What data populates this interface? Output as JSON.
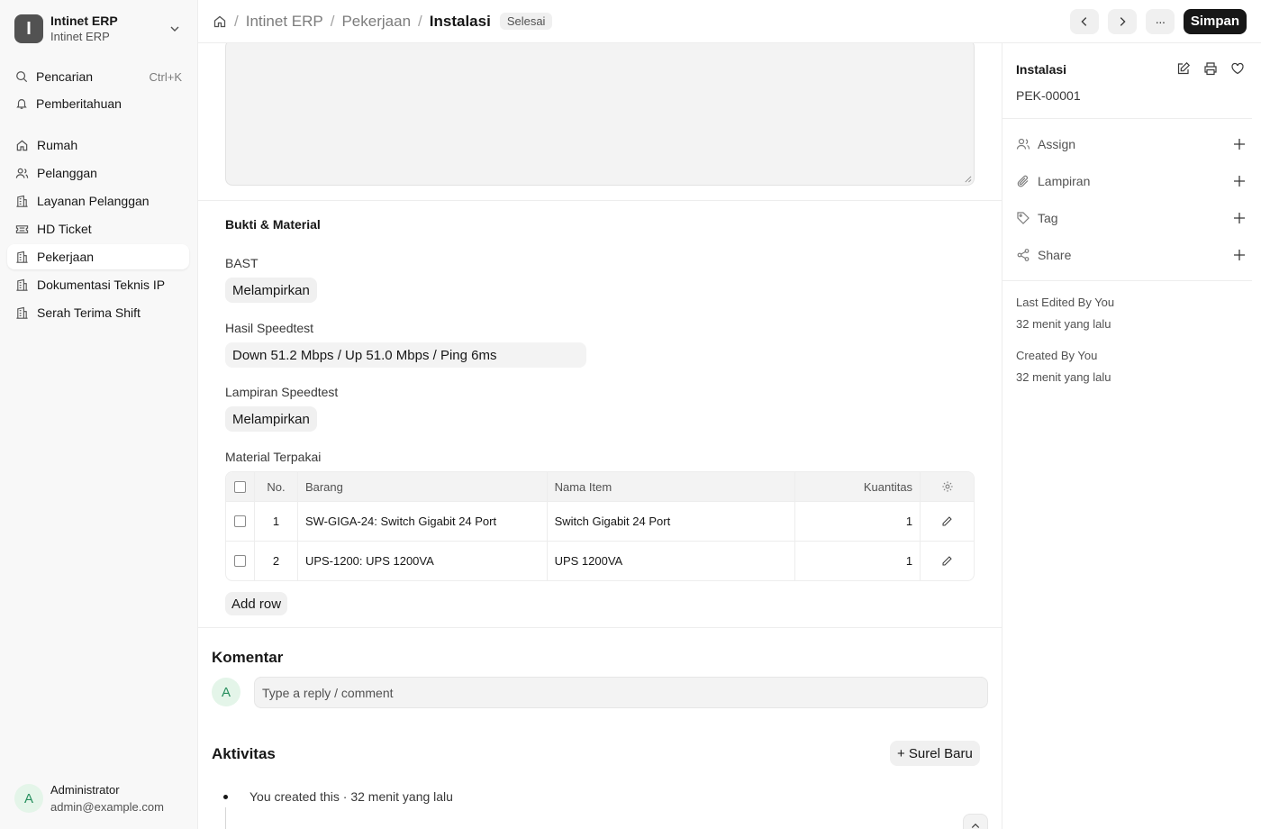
{
  "sidebar": {
    "workspace_title": "Intinet ERP",
    "workspace_sub": "Intinet ERP",
    "workspace_logo": "I",
    "search_label": "Pencarian",
    "search_shortcut": "Ctrl+K",
    "notifications_label": "Pemberitahuan",
    "items": [
      {
        "label": "Rumah",
        "icon": "home-icon"
      },
      {
        "label": "Pelanggan",
        "icon": "users-icon"
      },
      {
        "label": "Layanan Pelanggan",
        "icon": "building-icon"
      },
      {
        "label": "HD Ticket",
        "icon": "ticket-icon"
      },
      {
        "label": "Pekerjaan",
        "icon": "building-icon",
        "active": true
      },
      {
        "label": "Dokumentasi Teknis IP",
        "icon": "building-icon"
      },
      {
        "label": "Serah Terima Shift",
        "icon": "building-icon"
      }
    ],
    "user": {
      "initial": "A",
      "name": "Administrator",
      "email": "admin@example.com"
    }
  },
  "header": {
    "breadcrumbs": [
      "Intinet ERP",
      "Pekerjaan",
      "Instalasi"
    ],
    "status_badge": "Selesai",
    "more_label": "···",
    "save_label": "Simpan"
  },
  "form": {
    "section_title": "Bukti & Material",
    "bast_label": "BAST",
    "bast_button": "Melampirkan",
    "speedtest_label": "Hasil Speedtest",
    "speedtest_value": "Down 51.2 Mbps / Up 51.0 Mbps / Ping 6ms",
    "speedtest_attach_label": "Lampiran Speedtest",
    "speedtest_attach_button": "Melampirkan",
    "material_label": "Material Terpakai",
    "table": {
      "headers": [
        "No.",
        "Barang",
        "Nama Item",
        "Kuantitas"
      ],
      "rows": [
        {
          "no": "1",
          "barang": "SW-GIGA-24: Switch Gigabit 24 Port",
          "nama": "Switch Gigabit 24 Port",
          "qty": "1"
        },
        {
          "no": "2",
          "barang": "UPS-1200: UPS 1200VA",
          "nama": "UPS 1200VA",
          "qty": "1"
        }
      ]
    },
    "add_row_label": "Add row"
  },
  "comments": {
    "title": "Komentar",
    "avatar_initial": "A",
    "placeholder": "Type a reply / comment"
  },
  "activity": {
    "title": "Aktivitas",
    "new_email_label": "+ Surel Baru",
    "entries": [
      "You created this · 32 menit yang lalu"
    ]
  },
  "right_panel": {
    "title": "Instalasi",
    "doc_id": "PEK-00001",
    "actions": [
      {
        "label": "Assign",
        "icon": "user-assign-icon"
      },
      {
        "label": "Lampiran",
        "icon": "paperclip-icon"
      },
      {
        "label": "Tag",
        "icon": "tag-icon"
      },
      {
        "label": "Share",
        "icon": "share-icon"
      }
    ],
    "last_edited_label": "Last Edited By You",
    "last_edited_time": "32 menit yang lalu",
    "created_label": "Created By You",
    "created_time": "32 menit yang lalu"
  },
  "colors": {
    "primary_button": "#171717",
    "avatar_bg": "#e4f5e9",
    "avatar_fg": "#278f5e",
    "sidebar_bg": "#f8f8f8"
  }
}
